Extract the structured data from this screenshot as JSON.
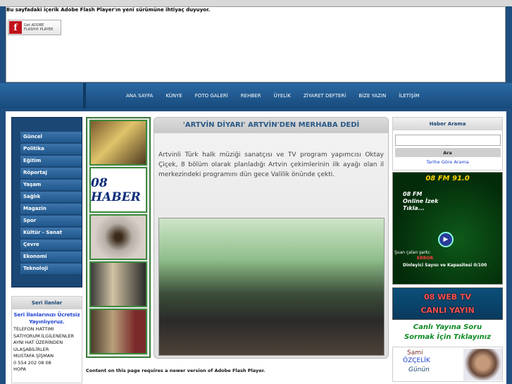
{
  "flash": {
    "message": "Bu sayfadaki içerik Adobe Flash Player'ın yeni sürümüne ihtiyaç duyuyor.",
    "get_adobe_line1": "Get ADOBE",
    "get_adobe_line2": "FLASH® PLAYER",
    "adobe_logo": "f"
  },
  "nav": {
    "items": [
      "ANA SAYFA",
      "KÜNYE",
      "FOTO GALERİ",
      "REHBER",
      "ÜYELİK",
      "ZİYARET DEFTERİ",
      "BİZE YAZIN",
      "İLETİŞİM"
    ]
  },
  "categories": [
    "Güncel",
    "Politika",
    "Eğitim",
    "Röportaj",
    "Yaşam",
    "Sağlık",
    "Magazin",
    "Spor",
    "Kültür - Sanat",
    "Çevre",
    "Ekonomi",
    "Teknoloji"
  ],
  "ilanlar": {
    "title": "Seri İlanlar",
    "promo": "Seri İlanlarınızı Ücretsiz Yayınlıyoruz.",
    "lines": [
      "TELEFON HATTIMI",
      "SATIYORUM.İLGİLENENLER",
      "AYNI HAT ÜZERİNDEN",
      "ULAŞABİLİRLER",
      "MUSTAFA ŞİŞMAN",
      "0 554 202 08 08",
      "HOPA"
    ]
  },
  "thumbs": {
    "t2_text": "08 HABER"
  },
  "news": {
    "title": "'ARTVİN DİYARI' ARTVİN'DEN MERHABA DEDİ",
    "body": "Artvinli Türk halk müziği sanatçısı ve TV program yapımcısı Oktay Çiçek, 8 bölüm olarak planladığı Artvin çekimlerinin ilk ayağı olan il merkezindeki programını dün gece Valilik önünde çekti."
  },
  "search": {
    "title": "Haber Arama",
    "button": "Ara",
    "date_link": "Tarihe Göre Arama"
  },
  "radio": {
    "title": "08 FM 91.0",
    "subtitle_line1": "08 FM",
    "subtitle_line2": "Online İzek",
    "subtitle_line3": "Tıkla...",
    "play_icon": "▶",
    "now_playing": "Şuan çalan şarkı:",
    "error": "ERROR",
    "listener_count": "Dinleyici Sayısı ve Kapasitesi 0/100"
  },
  "webtv": {
    "line1": "08 WEB TV",
    "line2": "CANLI YAYIN"
  },
  "soru": {
    "line1": "Canlı Yayına Soru",
    "line2": "Sormak İçin Tıklayınız"
  },
  "sami": {
    "name": "Sami",
    "surname": "ÖZÇELİK",
    "gunun": "Günün"
  },
  "bottom": {
    "message": "Content on this page requires a newer version of Adobe Flash Player."
  }
}
